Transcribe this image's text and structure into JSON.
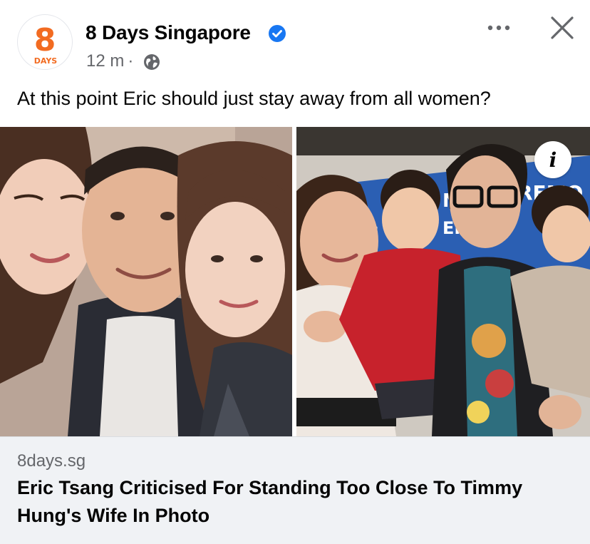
{
  "post": {
    "page_name": "8 Days Singapore",
    "avatar": {
      "number": "8",
      "label": "DAYS"
    },
    "time": "12 m",
    "separator": "·",
    "caption": "At this point Eric should just stay away from all women?"
  },
  "link_preview": {
    "domain": "8days.sg",
    "headline": "Eric Tsang Criticised For Standing Too Close To Timmy Hung's Wife In Photo"
  },
  "photo_right": {
    "backdrop_text_1": "N",
    "backdrop_text_2": "REMO",
    "backdrop_text_3": "C",
    "backdrop_text_4": "ENT"
  },
  "icons": {
    "verified": "verified-badge-icon",
    "audience": "globe-icon",
    "more": "more-options-icon",
    "close": "close-icon",
    "info": "info-icon"
  },
  "colors": {
    "brand_orange": "#f26b21",
    "verified_blue": "#1877f2",
    "meta_grey": "#65676b",
    "card_bg": "#f0f2f5"
  }
}
